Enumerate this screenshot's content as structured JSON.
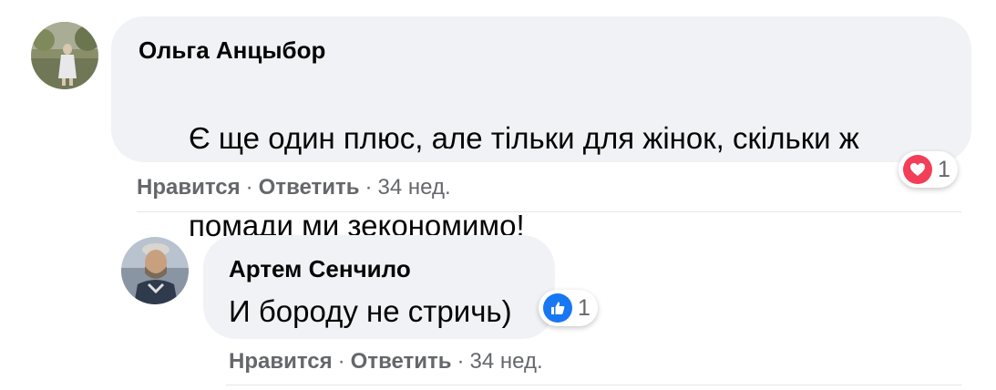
{
  "comments": [
    {
      "author": "Ольга Анцыбор",
      "text": "Є ще один плюс, але тільки для жінок, скільки ж помади ми зекономимо!",
      "text_line1": "Є ще один плюс, але тільки для жінок, скільки ж",
      "text_line2": "помади ми зекономимо!",
      "reaction": {
        "icon": "heart-icon",
        "count": "1",
        "color": "#f33e58"
      },
      "like_label": "Нравится",
      "reply_label": "Ответить",
      "separator": "·",
      "time": "34 нед."
    },
    {
      "author": "Артем Сенчило",
      "text": "И бороду не стричь)",
      "reaction": {
        "icon": "thumbs-up-icon",
        "count": "1",
        "color": "#1877f2"
      },
      "like_label": "Нравится",
      "reply_label": "Ответить",
      "separator": "·",
      "time": "34 нед."
    }
  ]
}
